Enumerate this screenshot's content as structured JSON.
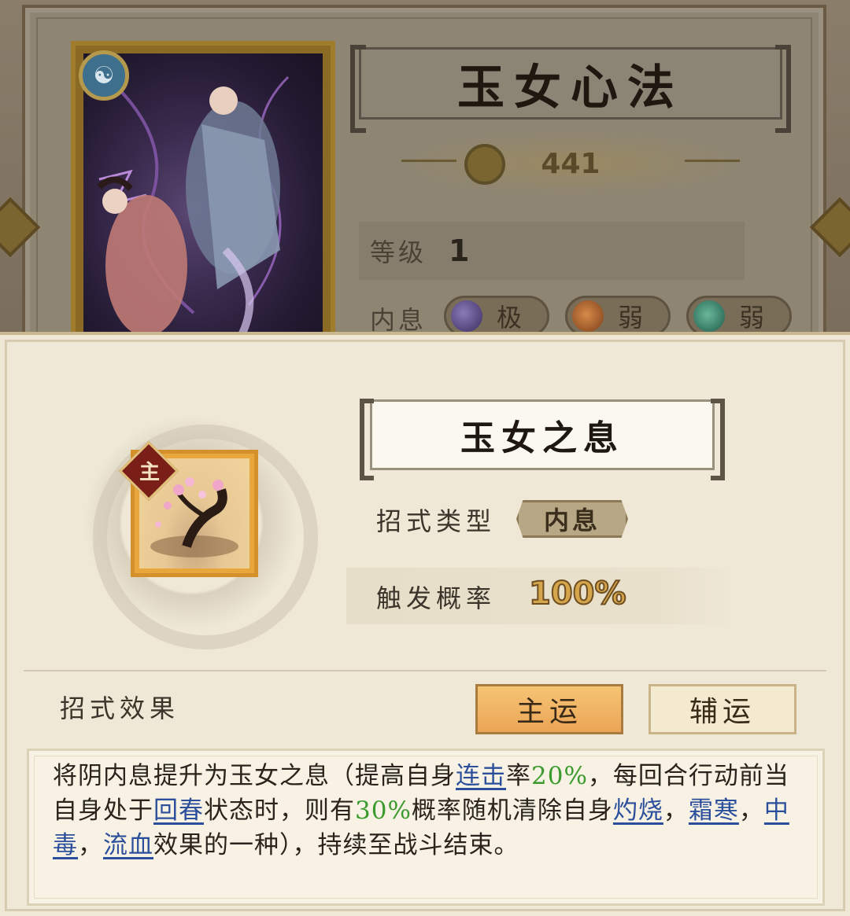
{
  "header": {
    "title": "玉女心法",
    "power": "441",
    "level_label": "等级",
    "level_value": "1",
    "neixi_label": "内息",
    "neixi_pills": [
      {
        "icon": "purple-moon-orb",
        "text": "极",
        "color": "#5b4a8a"
      },
      {
        "icon": "sun-orb",
        "text": "弱",
        "color": "#8a5a2a"
      },
      {
        "icon": "green-moon-orb",
        "text": "弱",
        "color": "#2a6a5a"
      }
    ]
  },
  "skill": {
    "badge": "主",
    "name": "玉女之息",
    "type_label": "招式类型",
    "type_value": "内息",
    "prob_label": "触发概率",
    "prob_value": "100%"
  },
  "effect": {
    "label": "招式效果",
    "tabs": [
      {
        "label": "主运",
        "active": true
      },
      {
        "label": "辅运",
        "active": false
      }
    ],
    "desc": {
      "t1": "将阴内息提升为玉女之息（提高自身",
      "k1": "连击",
      "t2": "率",
      "n1": "20%",
      "t3": "，每回合行动前当自身处于",
      "k2": "回春",
      "t4": "状态时，则有",
      "n2": "30%",
      "t5": "概率随机清除自身",
      "k3": "灼烧",
      "t6": "，",
      "k4": "霜寒",
      "t7": "，",
      "k5": "中毒",
      "t8": "，",
      "k6": "流血",
      "t9": "效果的一种），持续至战斗结束。"
    }
  },
  "colors": {
    "accent_orange": "#eba556",
    "keyword_blue": "#2c4f9c",
    "number_green": "#3b9a2e"
  }
}
